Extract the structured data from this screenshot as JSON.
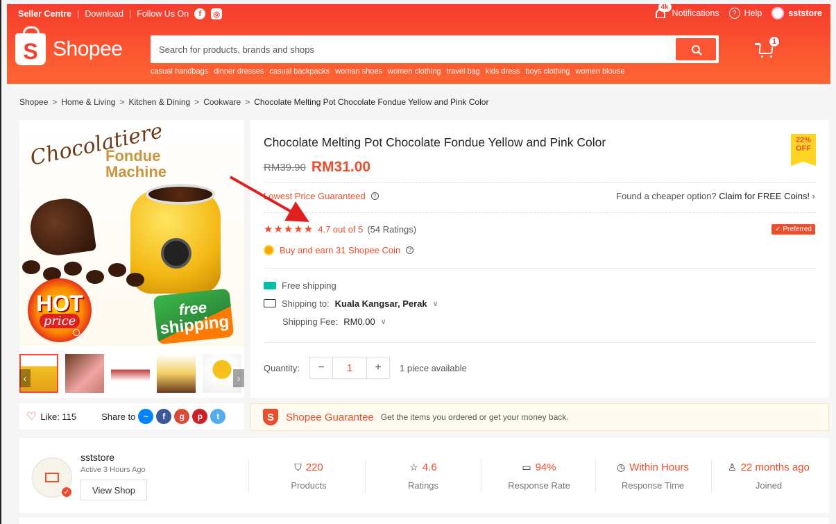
{
  "topbar": {
    "seller_centre": "Seller Centre",
    "download": "Download",
    "follow": "Follow Us On",
    "notif_badge": "4k",
    "notifications": "Notifications",
    "help": "Help",
    "user": "sststore"
  },
  "logo": {
    "text": "Shopee",
    "mark": "S"
  },
  "search": {
    "placeholder": "Search for products, brands and shops",
    "suggestions": [
      "casual handbags",
      "dinner dresses",
      "casual backpacks",
      "woman shoes",
      "women clothing",
      "travel bag",
      "kids dress",
      "boys clothing",
      "women blouse"
    ]
  },
  "cart": {
    "count": "1"
  },
  "breadcrumb": {
    "items": [
      "Shopee",
      "Home & Living",
      "Kitchen & Dining",
      "Cookware"
    ],
    "current": "Chocolate Melting Pot Chocolate Fondue Yellow and Pink Color",
    "separator": ">"
  },
  "gallery": {
    "choco_text": "Chocolatiere",
    "fondue_line1": "Fondue",
    "fondue_line2": "Machine",
    "hot_text": "HOT",
    "hot_price": "price",
    "free_text": "free",
    "shipping_text": "shipping"
  },
  "social": {
    "like_label": "Like: 115",
    "share_label": "Share to"
  },
  "product": {
    "title": "Chocolate Melting Pot Chocolate Fondue Yellow and Pink Color",
    "old_price": "RM39.90",
    "price": "RM31.00",
    "discount_pct": "22%",
    "discount_off": "OFF",
    "lowest_price": "Lowest Price Guaranteed",
    "cheaper_prefix": "Found a cheaper option?",
    "cheaper_link": "Claim for FREE Coins!",
    "rating_score": "4.7 out of 5",
    "rating_count": "(54 Ratings)",
    "rating_value": 4.7,
    "preferred": "✓ Preferred",
    "coins": "Buy and earn 31 Shopee Coin",
    "free_shipping": "Free shipping",
    "shipping_to_label": "Shipping to:",
    "shipping_to_value": "Kuala Kangsar, Perak",
    "shipping_fee_label": "Shipping Fee:",
    "shipping_fee_value": "RM0.00",
    "quantity_label": "Quantity:",
    "quantity_value": "1",
    "available": "1 piece available"
  },
  "guarantee": {
    "title": "Shopee Guarantee",
    "text": "Get the items you ordered or get your money back."
  },
  "shop": {
    "name": "sststore",
    "active": "Active 3 Hours Ago",
    "view_shop": "View Shop",
    "stats": [
      {
        "value": "220",
        "label": "Products",
        "icon": "shop-bag-icon"
      },
      {
        "value": "4.6",
        "label": "Ratings",
        "icon": "star-outline-icon"
      },
      {
        "value": "94%",
        "label": "Response Rate",
        "icon": "chat-icon"
      },
      {
        "value": "Within Hours",
        "label": "Response Time",
        "icon": "clock-icon"
      },
      {
        "value": "22 months ago",
        "label": "Joined",
        "icon": "person-icon"
      }
    ]
  },
  "colors": {
    "brand": "#ee4d2d",
    "arrow": "#e02020"
  }
}
